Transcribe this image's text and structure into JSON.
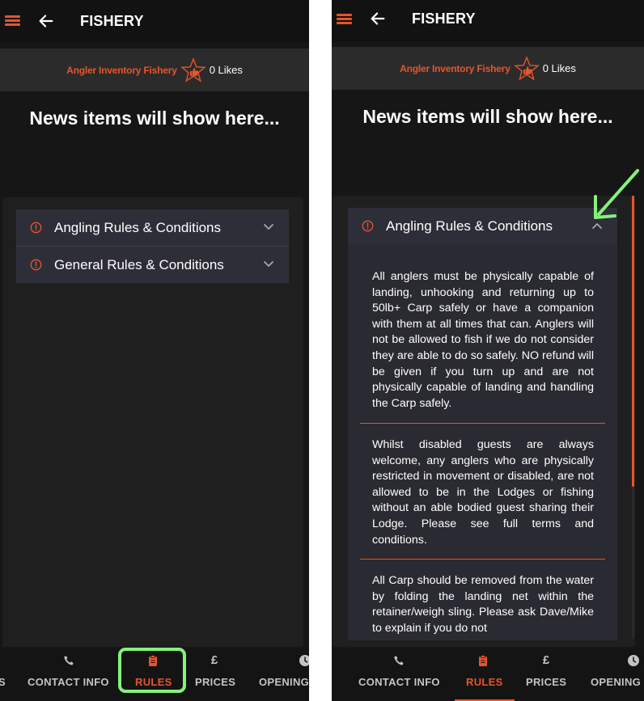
{
  "appbar": {
    "title": "FISHERY"
  },
  "fishery": {
    "name": "Angler Inventory Fishery",
    "likes": "0 Likes"
  },
  "news": {
    "placeholder": "News items will show here..."
  },
  "accordion": {
    "angling": {
      "label": "Angling Rules & Conditions"
    },
    "general": {
      "label": "General Rules & Conditions"
    }
  },
  "rules": [
    "All anglers must be physically capable of landing, unhooking and returning up to 50lb+ Carp safely or have a companion with them at all times that can. Anglers will not be allowed to fish if we do not consider they are able to do so safely. NO refund will be given if you turn up and are not physically capable of landing and handling the Carp safely.",
    "Whilst disabled guests are always welcome, any anglers who are physically restricted in movement or disabled, are not allowed to be in the Lodges or fishing without an able bodied guest sharing their Lodge. Please see full terms and conditions.",
    "All Carp should be removed from the water by folding the landing net within the retainer/weigh sling. Please ask Dave/Mike to explain if you do not"
  ],
  "nav": {
    "partial_left": "S",
    "contact": "CONTACT INFO",
    "rules": "RULES",
    "prices": "PRICES",
    "opening": "OPENING"
  },
  "icons": {
    "menu": "menu-icon",
    "back": "back-arrow-icon",
    "star": "star-thumbs-up-icon",
    "alert": "alert-circle-icon",
    "chevron": "chevron-icon",
    "phone": "phone-icon",
    "clipboard": "clipboard-icon",
    "pound": "pound-sign-icon",
    "clock": "clock-icon"
  },
  "colors": {
    "accent": "#e8542b",
    "background": "#161616",
    "accordion": "#2e2e38",
    "annotation": "#84f27a"
  },
  "annotation": {
    "arrow_points_to": "collapse chevron of Angling Rules & Conditions",
    "highlight": "RULES tab"
  }
}
